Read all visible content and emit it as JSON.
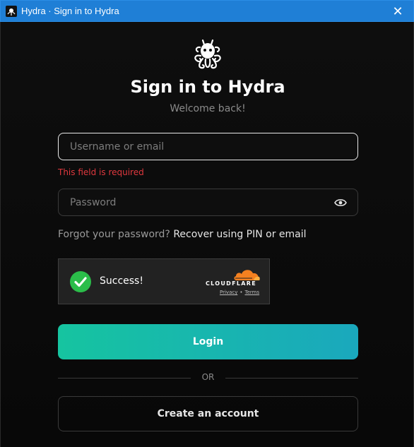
{
  "window": {
    "title": "Hydra · Sign in to Hydra",
    "app_icon": "hydra-icon",
    "close_glyph": "✕"
  },
  "header": {
    "logo": "hydra-logo",
    "title": "Sign in to Hydra",
    "subtitle": "Welcome back!"
  },
  "form": {
    "username_placeholder": "Username or email",
    "username_value": "",
    "username_error": "This field is required",
    "password_placeholder": "Password",
    "password_value": "",
    "password_toggle_icon": "eye-icon",
    "forgot_prefix": "Forgot your password?",
    "forgot_link": "Recover using PIN or email"
  },
  "captcha": {
    "status": "Success!",
    "provider": "CLOUDFLARE",
    "privacy": "Privacy",
    "separator": "•",
    "terms": "Terms"
  },
  "actions": {
    "login_label": "Login",
    "divider_label": "OR",
    "create_account_label": "Create an account"
  },
  "colors": {
    "titlebar": "#1f7fd6",
    "error": "#e0383e",
    "accent_start": "#16c4a0",
    "accent_end": "#1aa8bd",
    "success": "#2bbd4a",
    "cloudflare_orange": "#f38020"
  }
}
